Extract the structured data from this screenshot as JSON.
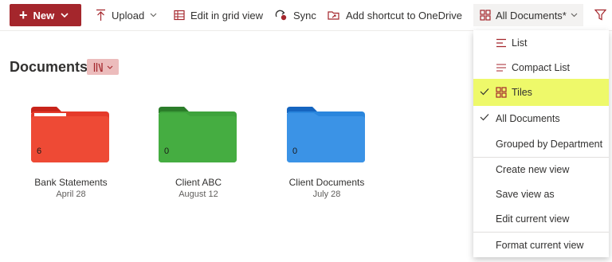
{
  "colors": {
    "accent": "#a4262c",
    "folder_red": "#e53a2a",
    "folder_green": "#3ea33c",
    "folder_blue": "#2a86dd",
    "highlight": "#eef96a"
  },
  "toolbar": {
    "new_label": "New",
    "upload_label": "Upload",
    "edit_grid_label": "Edit in grid view",
    "sync_label": "Sync",
    "shortcut_label": "Add shortcut to OneDrive",
    "view_label": "All Documents*",
    "icons": [
      "plus-icon",
      "upload-icon",
      "grid-edit-icon",
      "sync-icon",
      "shortcut-icon",
      "tiles-icon",
      "filter-icon"
    ]
  },
  "page": {
    "title": "Documents"
  },
  "tiles": [
    {
      "name": "Bank Statements",
      "date": "April 28",
      "count": "6",
      "color": "#e53a2a"
    },
    {
      "name": "Client ABC",
      "date": "August 12",
      "count": "0",
      "color": "#3ea33c"
    },
    {
      "name": "Client Documents",
      "date": "July 28",
      "count": "0",
      "color": "#2a86dd"
    }
  ],
  "view_menu": {
    "items": [
      {
        "label": "List",
        "icon": "list-icon",
        "checked": false
      },
      {
        "label": "Compact List",
        "icon": "compact-list-icon",
        "checked": false
      },
      {
        "label": "Tiles",
        "icon": "tiles-icon",
        "checked": true,
        "highlighted": true
      },
      {
        "label": "All Documents",
        "checked": true
      },
      {
        "label": "Grouped by Department",
        "checked": false
      },
      {
        "label": "Create new view"
      },
      {
        "label": "Save view as"
      },
      {
        "label": "Edit current view"
      },
      {
        "label": "Format current view"
      }
    ]
  }
}
